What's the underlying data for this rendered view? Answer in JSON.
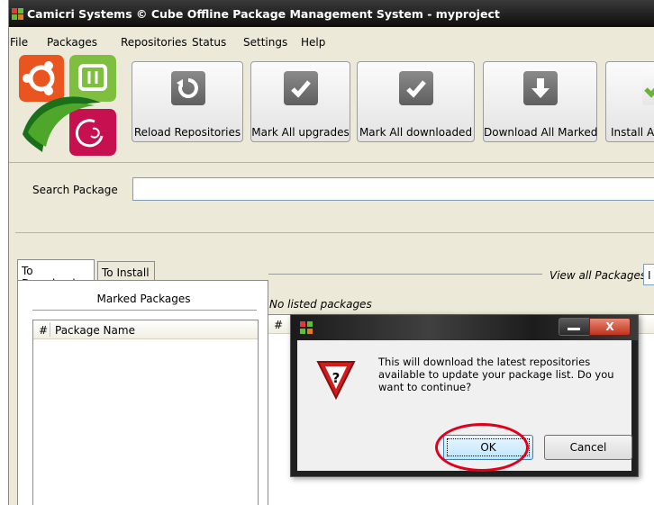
{
  "window": {
    "title": "Camicri Systems © Cube Offline Package Management System - myproject"
  },
  "menu": [
    "File",
    "Packages",
    "Repositories",
    "Status",
    "Settings",
    "Help"
  ],
  "toolbar": [
    {
      "label": "Reload Repositories",
      "icon": "reload-icon"
    },
    {
      "label": "Mark All upgrades",
      "icon": "checkmark-icon"
    },
    {
      "label": "Mark All downloaded",
      "icon": "checkmark-icon"
    },
    {
      "label": "Download All Marked",
      "icon": "download-arrow-icon"
    },
    {
      "label": "Install Al",
      "icon": "install-check-icon"
    }
  ],
  "search": {
    "label": "Search Package",
    "value": ""
  },
  "left_panel": {
    "tabs": [
      "To Download",
      "To Install"
    ],
    "active_tab": "To Download",
    "title": "Marked Packages",
    "columns": [
      "#",
      "Package Name"
    ]
  },
  "right_panel": {
    "view_label": "View all Packages",
    "view_selected": "I",
    "status": "No listed packages",
    "columns": [
      "#"
    ]
  },
  "dialog": {
    "message": "This will download the latest repositories available to update your package list. Do you want to continue?",
    "ok_label": "OK",
    "cancel_label": "Cancel",
    "close_glyph": "X"
  },
  "colors": {
    "highlight": "#e0001b",
    "titlebar": "#1a1a1a",
    "window_bg": "#ece9d8"
  }
}
